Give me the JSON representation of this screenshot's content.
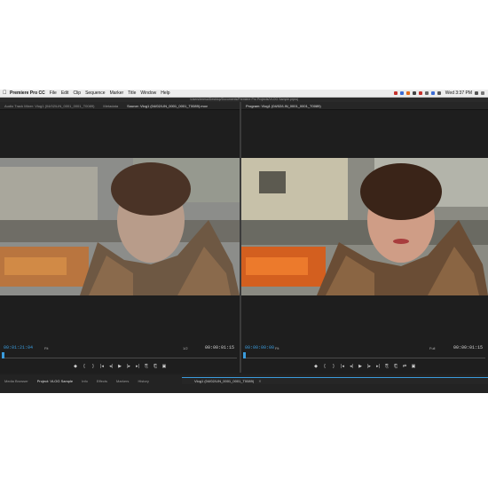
{
  "menubar": {
    "app": "Premiere Pro CC",
    "items": [
      "File",
      "Edit",
      "Clip",
      "Sequence",
      "Marker",
      "Title",
      "Window",
      "Help"
    ],
    "clock": "Wed 3:37 PM"
  },
  "window": {
    "path": "/Users/teresa/Desktop/Documents/Premiere Pro Projects/VLOG Sample.prproj"
  },
  "source_panel": {
    "tabs": [
      "Audio Track Mixer: Vlog1 (04/02/LIN_0001_0001_T0089)",
      "Metadata",
      "Source: Vlog1 (04/02/LIN_0001_0001_T0089).mov"
    ],
    "timecode_in": "00:01:21:04",
    "fit": "Fit",
    "resolution": "1/2",
    "timecode_out": "00:00:01:15"
  },
  "program_panel": {
    "tabs": [
      "Program: Vlog1 (04/02/LIN_0001_0001_T0089)"
    ],
    "timecode_in": "00:00:00:00",
    "fit": "Fit",
    "resolution": "Full",
    "timecode_out": "00:00:01:15"
  },
  "transport": [
    "◆",
    "{",
    "}",
    "|◂",
    "◂|",
    "▶",
    "|▸",
    "▸|",
    "⎘",
    "⎗",
    "⇄",
    "▣"
  ],
  "bottom": {
    "tabs": [
      "Media Browser",
      "Project: VLOG Sample",
      "Info",
      "Effects",
      "Markers",
      "History"
    ],
    "timeline": "Vlog1 (04/02/LIN_0001_0001_T0089)"
  }
}
